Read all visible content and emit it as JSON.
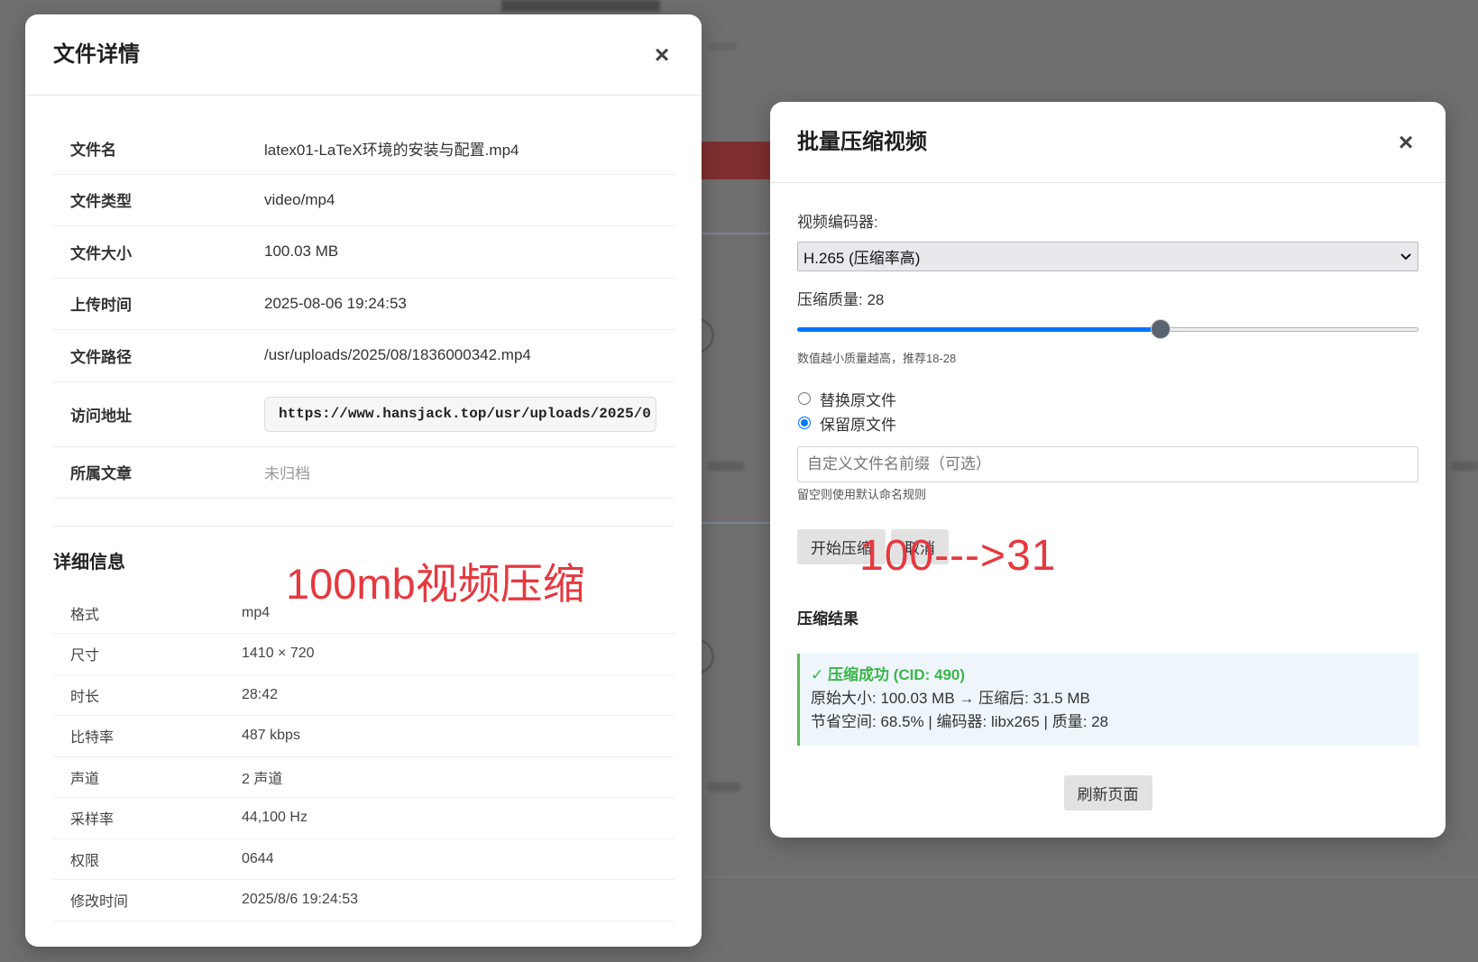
{
  "colors": {
    "backdrop": "#6f6f6f",
    "annotation_red": "#e5393f",
    "success_green": "#3bb54a",
    "result_border": "#5cb85c",
    "result_bg": "#eef6fc",
    "slider_blue": "#0075ff"
  },
  "file_details_modal": {
    "title": "文件详情",
    "close_icon": "close-icon",
    "close_glyph": "×",
    "info_rows": [
      {
        "label": "文件名",
        "value": "latex01-LaTeX环境的安装与配置.mp4"
      },
      {
        "label": "文件类型",
        "value": "video/mp4"
      },
      {
        "label": "文件大小",
        "value": "100.03 MB"
      },
      {
        "label": "上传时间",
        "value": "2025-08-06 19:24:53"
      },
      {
        "label": "文件路径",
        "value": "/usr/uploads/2025/08/1836000342.mp4"
      },
      {
        "label": "访问地址",
        "value": "https://www.hansjack.top/usr/uploads/2025/0"
      },
      {
        "label": "所属文章",
        "value": "未归档"
      }
    ],
    "details_heading": "详细信息",
    "detail_rows": [
      {
        "label": "格式",
        "value": "mp4"
      },
      {
        "label": "尺寸",
        "value": "1410 × 720"
      },
      {
        "label": "时长",
        "value": "28:42"
      },
      {
        "label": "比特率",
        "value": "487 kbps"
      },
      {
        "label": "声道",
        "value": "2 声道"
      },
      {
        "label": "采样率",
        "value": "44,100 Hz"
      },
      {
        "label": "权限",
        "value": "0644"
      },
      {
        "label": "修改时间",
        "value": "2025/8/6 19:24:53"
      }
    ]
  },
  "compress_modal": {
    "title": "批量压缩视频",
    "close_icon": "close-icon",
    "close_glyph": "×",
    "encoder_label": "视频编码器:",
    "encoder_selected": "H.265 (压缩率高)",
    "encoder_chevron_icon": "chevron-down-icon",
    "quality_label": "压缩质量:",
    "quality_value": "28",
    "quality_slider_fill": 0.585,
    "quality_hint": "数值越小质量越高，推荐18-28",
    "file_options": [
      {
        "label": "替换原文件",
        "checked": false
      },
      {
        "label": "保留原文件",
        "checked": true
      }
    ],
    "prefix_placeholder": "自定义文件名前缀（可选）",
    "prefix_hint": "留空则使用默认命名规则",
    "start_button": "开始压缩",
    "cancel_button": "取消",
    "result_heading": "压缩结果",
    "result": {
      "status": "✓ 压缩成功 (CID: 490)",
      "sizes": "原始大小: 100.03 MB → 压缩后: 31.5 MB",
      "summary": "节省空间: 68.5% | 编码器: libx265 | 质量: 28"
    },
    "refresh_button": "刷新页面"
  },
  "annotations": {
    "left": "100mb视频压缩",
    "right": "100--->31"
  }
}
